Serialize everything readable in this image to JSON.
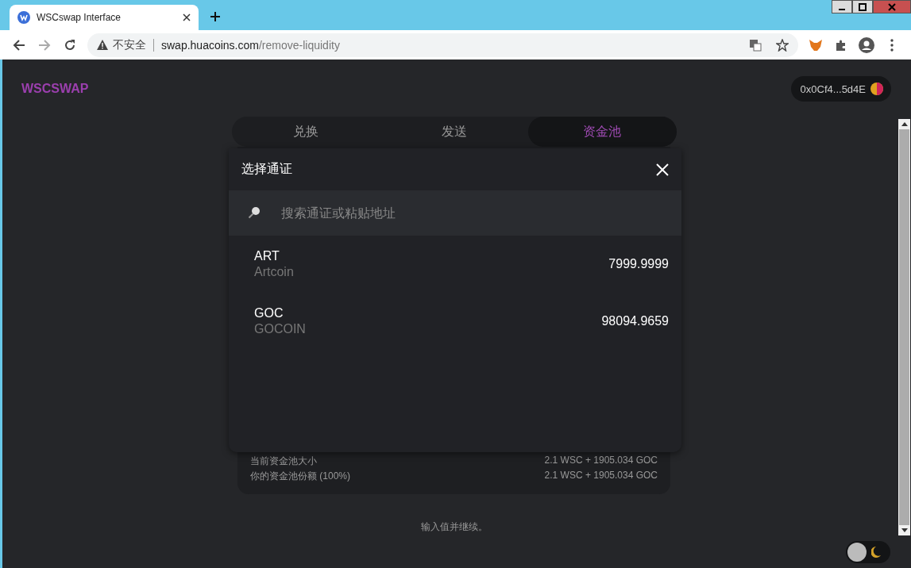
{
  "browser": {
    "tab_title": "WSCswap Interface",
    "security_label": "不安全",
    "url_host": "swap.huacoins.com",
    "url_path": "/remove-liquidity"
  },
  "header": {
    "logo": "WSCSWAP",
    "wallet_address": "0x0Cf4...5d4E"
  },
  "tabs": [
    {
      "label": "兑换",
      "selected": false
    },
    {
      "label": "发送",
      "selected": false
    },
    {
      "label": "资金池",
      "selected": true
    }
  ],
  "pool_info": [
    {
      "label": "当前资金池大小",
      "value": "2.1 WSC + 1905.034 GOC"
    },
    {
      "label": "你的资金池份额 (100%)",
      "value": "2.1 WSC + 1905.034 GOC"
    }
  ],
  "hint": "输入值并继续。",
  "modal": {
    "title": "选择通证",
    "search": {
      "placeholder": "搜索通证或粘贴地址"
    },
    "tokens": [
      {
        "symbol": "ART",
        "name": "Artcoin",
        "balance": "7999.9999"
      },
      {
        "symbol": "GOC",
        "name": "GOCOIN",
        "balance": "98094.9659"
      }
    ]
  },
  "theme_toggle": {
    "on": true
  }
}
